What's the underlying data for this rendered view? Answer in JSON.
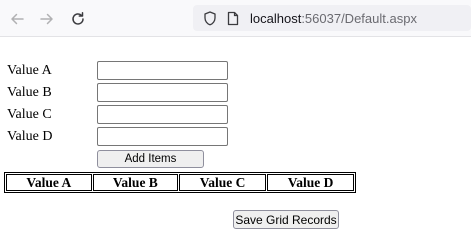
{
  "browser": {
    "url_host": "localhost",
    "url_rest": ":56037/Default.aspx"
  },
  "form": {
    "fields": [
      {
        "label": "Value A",
        "value": ""
      },
      {
        "label": "Value B",
        "value": ""
      },
      {
        "label": "Value C",
        "value": ""
      },
      {
        "label": "Value D",
        "value": ""
      }
    ],
    "add_button": "Add Items"
  },
  "grid": {
    "headers": [
      "Value A",
      "Value B",
      "Value C",
      "Value D"
    ]
  },
  "save_button": "Save Grid Records",
  "colors": {
    "toolbar_bg": "#f9f9fb",
    "urlbar_bg": "#f0f0f4",
    "button_bg": "#efefef"
  }
}
